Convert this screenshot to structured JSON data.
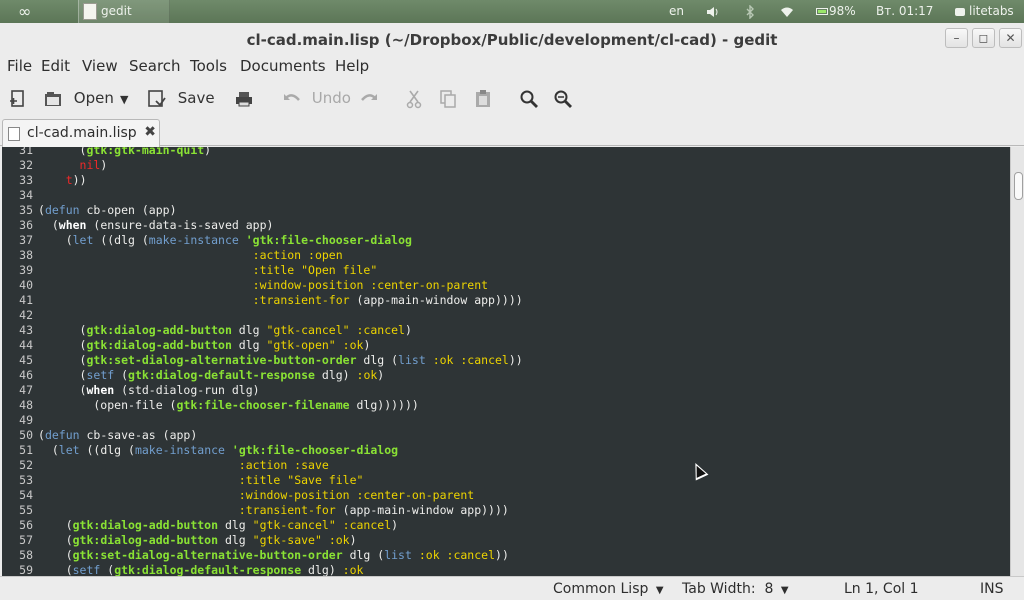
{
  "panel": {
    "menu_logo": "∞",
    "task_label": "gedit",
    "lang": "en",
    "battery": "98%",
    "clock": "Вт. 01:17",
    "user": "litetabs"
  },
  "window": {
    "title": "cl-cad.main.lisp (~/Dropbox/Public/development/cl-cad) - gedit"
  },
  "menubar": [
    "File",
    "Edit",
    "View",
    "Search",
    "Tools",
    "Documents",
    "Help"
  ],
  "toolbar": {
    "open_label": "Open",
    "save_label": "Save",
    "undo_label": "Undo"
  },
  "tab": {
    "label": "cl-cad.main.lisp"
  },
  "editor": {
    "lines": [
      {
        "n": "31",
        "segs": [
          {
            "t": "      (",
            "c": ""
          },
          {
            "t": "gtk:gtk-main-quit",
            "c": "k-gtk"
          },
          {
            "t": ")",
            "c": ""
          }
        ]
      },
      {
        "n": "32",
        "segs": [
          {
            "t": "      ",
            "c": ""
          },
          {
            "t": "nil",
            "c": "k-const"
          },
          {
            "t": ")",
            "c": ""
          }
        ]
      },
      {
        "n": "33",
        "segs": [
          {
            "t": "    ",
            "c": ""
          },
          {
            "t": "t",
            "c": "k-const"
          },
          {
            "t": "))",
            "c": ""
          }
        ]
      },
      {
        "n": "34",
        "segs": []
      },
      {
        "n": "35",
        "segs": [
          {
            "t": "(",
            "c": ""
          },
          {
            "t": "defun",
            "c": "k-blue"
          },
          {
            "t": " cb-open (app)",
            "c": ""
          }
        ]
      },
      {
        "n": "36",
        "segs": [
          {
            "t": "  (",
            "c": ""
          },
          {
            "t": "when",
            "c": "k-kw"
          },
          {
            "t": " (ensure-data-is-saved app)",
            "c": ""
          }
        ]
      },
      {
        "n": "37",
        "segs": [
          {
            "t": "    (",
            "c": ""
          },
          {
            "t": "let",
            "c": "k-blue"
          },
          {
            "t": " ((dlg (",
            "c": ""
          },
          {
            "t": "make-instance",
            "c": "k-blue"
          },
          {
            "t": " ",
            "c": ""
          },
          {
            "t": "'gtk:file-chooser-dialog",
            "c": "k-gtk"
          }
        ]
      },
      {
        "n": "38",
        "segs": [
          {
            "t": "                               ",
            "c": ""
          },
          {
            "t": ":action :open",
            "c": "k-key"
          }
        ]
      },
      {
        "n": "39",
        "segs": [
          {
            "t": "                               ",
            "c": ""
          },
          {
            "t": ":title ",
            "c": "k-key"
          },
          {
            "t": "\"Open file\"",
            "c": "k-str"
          }
        ]
      },
      {
        "n": "40",
        "segs": [
          {
            "t": "                               ",
            "c": ""
          },
          {
            "t": ":window-position :center-on-parent",
            "c": "k-key"
          }
        ]
      },
      {
        "n": "41",
        "segs": [
          {
            "t": "                               ",
            "c": ""
          },
          {
            "t": ":transient-for",
            "c": "k-key"
          },
          {
            "t": " (app-main-window app))))",
            "c": ""
          }
        ]
      },
      {
        "n": "42",
        "segs": []
      },
      {
        "n": "43",
        "segs": [
          {
            "t": "      (",
            "c": ""
          },
          {
            "t": "gtk:dialog-add-button",
            "c": "k-gtk"
          },
          {
            "t": " dlg ",
            "c": ""
          },
          {
            "t": "\"gtk-cancel\" :cancel",
            "c": "k-str"
          },
          {
            "t": ")",
            "c": ""
          }
        ]
      },
      {
        "n": "44",
        "segs": [
          {
            "t": "      (",
            "c": ""
          },
          {
            "t": "gtk:dialog-add-button",
            "c": "k-gtk"
          },
          {
            "t": " dlg ",
            "c": ""
          },
          {
            "t": "\"gtk-open\" :ok",
            "c": "k-str"
          },
          {
            "t": ")",
            "c": ""
          }
        ]
      },
      {
        "n": "45",
        "segs": [
          {
            "t": "      (",
            "c": ""
          },
          {
            "t": "gtk:set-dialog-alternative-button-order",
            "c": "k-gtk"
          },
          {
            "t": " dlg (",
            "c": ""
          },
          {
            "t": "list",
            "c": "k-blue"
          },
          {
            "t": " ",
            "c": ""
          },
          {
            "t": ":ok :cancel",
            "c": "k-key"
          },
          {
            "t": "))",
            "c": ""
          }
        ]
      },
      {
        "n": "46",
        "segs": [
          {
            "t": "      (",
            "c": ""
          },
          {
            "t": "setf",
            "c": "k-blue"
          },
          {
            "t": " (",
            "c": ""
          },
          {
            "t": "gtk:dialog-default-response",
            "c": "k-gtk"
          },
          {
            "t": " dlg) ",
            "c": ""
          },
          {
            "t": ":ok",
            "c": "k-key"
          },
          {
            "t": ")",
            "c": ""
          }
        ]
      },
      {
        "n": "47",
        "segs": [
          {
            "t": "      (",
            "c": ""
          },
          {
            "t": "when",
            "c": "k-kw"
          },
          {
            "t": " (std-dialog-run dlg)",
            "c": ""
          }
        ]
      },
      {
        "n": "48",
        "segs": [
          {
            "t": "        (open-file (",
            "c": ""
          },
          {
            "t": "gtk:file-chooser-filename",
            "c": "k-gtk"
          },
          {
            "t": " dlg))))))",
            "c": ""
          }
        ]
      },
      {
        "n": "49",
        "segs": []
      },
      {
        "n": "50",
        "segs": [
          {
            "t": "(",
            "c": ""
          },
          {
            "t": "defun",
            "c": "k-blue"
          },
          {
            "t": " cb-save-as (app)",
            "c": ""
          }
        ]
      },
      {
        "n": "51",
        "segs": [
          {
            "t": "  (",
            "c": ""
          },
          {
            "t": "let",
            "c": "k-blue"
          },
          {
            "t": " ((dlg (",
            "c": ""
          },
          {
            "t": "make-instance",
            "c": "k-blue"
          },
          {
            "t": " ",
            "c": ""
          },
          {
            "t": "'gtk:file-chooser-dialog",
            "c": "k-gtk"
          }
        ]
      },
      {
        "n": "52",
        "segs": [
          {
            "t": "                             ",
            "c": ""
          },
          {
            "t": ":action :save",
            "c": "k-key"
          }
        ]
      },
      {
        "n": "53",
        "segs": [
          {
            "t": "                             ",
            "c": ""
          },
          {
            "t": ":title ",
            "c": "k-key"
          },
          {
            "t": "\"Save file\"",
            "c": "k-str"
          }
        ]
      },
      {
        "n": "54",
        "segs": [
          {
            "t": "                             ",
            "c": ""
          },
          {
            "t": ":window-position :center-on-parent",
            "c": "k-key"
          }
        ]
      },
      {
        "n": "55",
        "segs": [
          {
            "t": "                             ",
            "c": ""
          },
          {
            "t": ":transient-for",
            "c": "k-key"
          },
          {
            "t": " (app-main-window app))))",
            "c": ""
          }
        ]
      },
      {
        "n": "56",
        "segs": [
          {
            "t": "    (",
            "c": ""
          },
          {
            "t": "gtk:dialog-add-button",
            "c": "k-gtk"
          },
          {
            "t": " dlg ",
            "c": ""
          },
          {
            "t": "\"gtk-cancel\" :cancel",
            "c": "k-str"
          },
          {
            "t": ")",
            "c": ""
          }
        ]
      },
      {
        "n": "57",
        "segs": [
          {
            "t": "    (",
            "c": ""
          },
          {
            "t": "gtk:dialog-add-button",
            "c": "k-gtk"
          },
          {
            "t": " dlg ",
            "c": ""
          },
          {
            "t": "\"gtk-save\" :ok",
            "c": "k-str"
          },
          {
            "t": ")",
            "c": ""
          }
        ]
      },
      {
        "n": "58",
        "segs": [
          {
            "t": "    (",
            "c": ""
          },
          {
            "t": "gtk:set-dialog-alternative-button-order",
            "c": "k-gtk"
          },
          {
            "t": " dlg (",
            "c": ""
          },
          {
            "t": "list",
            "c": "k-blue"
          },
          {
            "t": " ",
            "c": ""
          },
          {
            "t": ":ok :cancel",
            "c": "k-key"
          },
          {
            "t": "))",
            "c": ""
          }
        ]
      },
      {
        "n": "59",
        "segs": [
          {
            "t": "    (",
            "c": ""
          },
          {
            "t": "setf",
            "c": "k-blue"
          },
          {
            "t": " (",
            "c": ""
          },
          {
            "t": "gtk:dialog-default-response",
            "c": "k-gtk"
          },
          {
            "t": " dlg) ",
            "c": ""
          },
          {
            "t": ":ok",
            "c": "k-key"
          }
        ]
      }
    ]
  },
  "statusbar": {
    "language": "Common Lisp",
    "tab_width": "Tab Width:  8",
    "position": "Ln 1, Col 1",
    "mode": "INS"
  },
  "colors": {
    "editor_bg": "#2e3436",
    "keyword_green": "#8ae234",
    "string_yellow": "#edd400",
    "builtin_blue": "#729fcf",
    "constant_red": "#ef2929"
  },
  "icons": {
    "new": "new-document-icon",
    "open": "open-folder-icon",
    "save": "save-icon",
    "print": "print-icon",
    "undo": "undo-icon",
    "redo": "redo-icon",
    "cut": "cut-icon",
    "copy": "copy-icon",
    "paste": "paste-icon",
    "find": "search-icon",
    "replace": "find-replace-icon"
  }
}
